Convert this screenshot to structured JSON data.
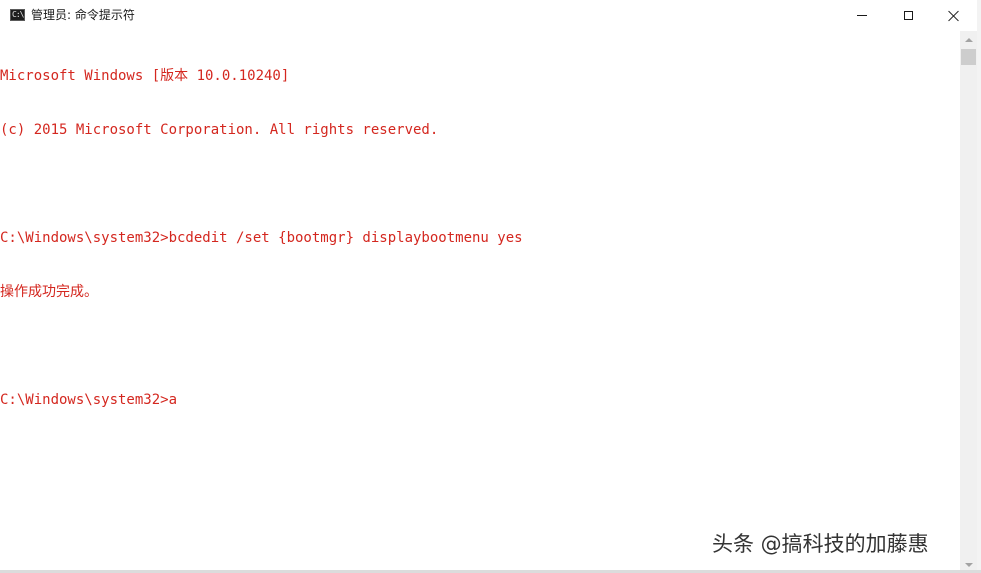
{
  "window": {
    "title": "管理员: 命令提示符",
    "icon": "cmd-icon",
    "icon_text": "C:\\"
  },
  "controls": {
    "minimize": "minimize-icon",
    "maximize": "maximize-icon",
    "close": "close-icon"
  },
  "console": {
    "text_color": "#d4271f",
    "background": "#ffffff",
    "lines": [
      "Microsoft Windows [版本 10.0.10240]",
      "(c) 2015 Microsoft Corporation. All rights reserved.",
      "",
      "C:\\Windows\\system32>bcdedit /set {bootmgr} displaybootmenu yes",
      "操作成功完成。",
      "",
      "C:\\Windows\\system32>a"
    ]
  },
  "watermark": {
    "text": "头条 @搞科技的加藤惠"
  }
}
